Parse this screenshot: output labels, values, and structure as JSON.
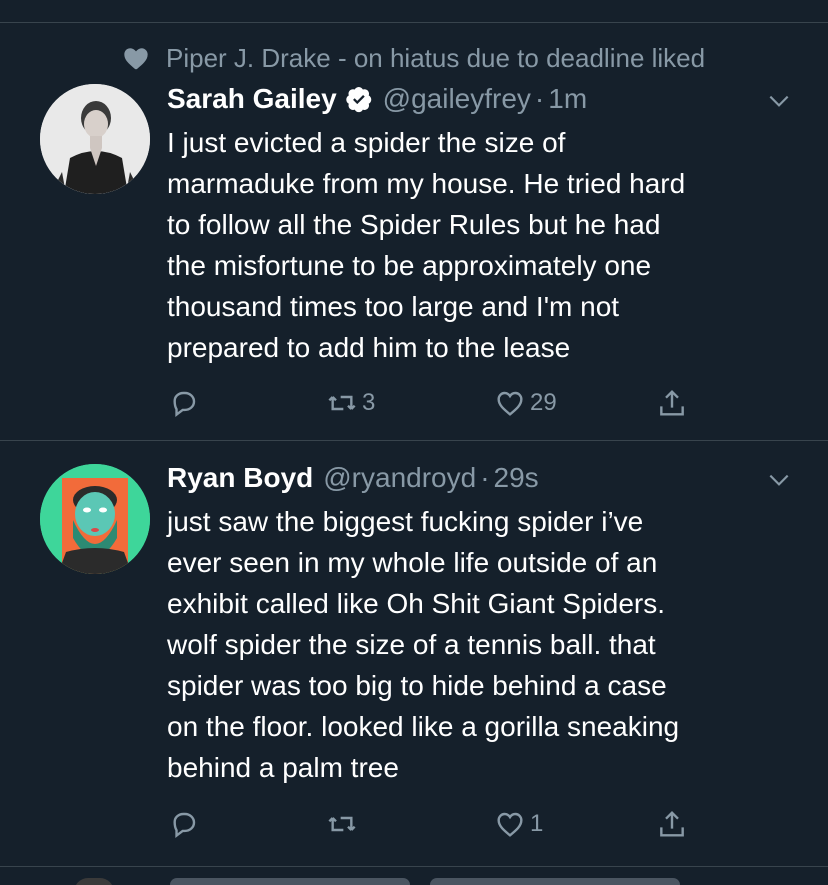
{
  "tweets": [
    {
      "social_context": "Piper J. Drake - on hiatus due to deadline liked",
      "name": "Sarah Gailey",
      "verified": true,
      "handle": "@gaileyfrey",
      "separator": "·",
      "time": "1m",
      "lines": [
        "I just evicted a spider the size of",
        "marmaduke from my house. He tried hard",
        "to follow all the Spider Rules but he had",
        "the misfortune to be approximately one",
        "thousand times too large and I'm not",
        "prepared to add him to the lease"
      ],
      "retweets": "3",
      "likes": "29"
    },
    {
      "name": "Ryan Boyd",
      "handle": "@ryandroyd",
      "separator": "·",
      "time": "29s",
      "lines": [
        "just saw the biggest fucking spider i’ve",
        "ever seen in my whole life outside of an",
        "exhibit called like Oh Shit Giant Spiders.",
        "wolf spider the size of a tennis ball. that",
        "spider was too big to hide behind a case",
        "on the floor. looked like a gorilla sneaking",
        "behind a palm tree"
      ],
      "retweets": "",
      "likes": "1"
    }
  ],
  "colors": {
    "background": "#15202b",
    "divider": "#38444d",
    "muted": "#8899a6",
    "text": "#ffffff",
    "avatar2_bg": "#3ed69a"
  },
  "icons": [
    "heart-icon",
    "verified-badge-icon",
    "chevron-down-icon",
    "reply-icon",
    "retweet-icon",
    "like-icon",
    "share-icon"
  ]
}
